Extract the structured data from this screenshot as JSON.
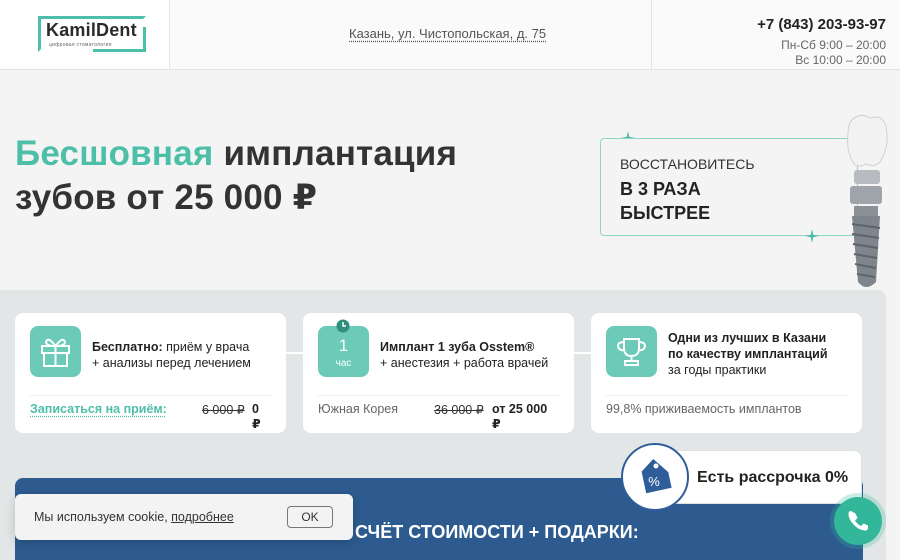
{
  "header": {
    "logo_name": "KamilDent",
    "logo_sub": "цифровая стоматология",
    "address": "Казань, ул. Чистопольская, д. 75",
    "phone": "+7 (843) 203-93-97",
    "hours_weekdays": "Пн-Сб 9:00 – 20:00",
    "hours_sunday": "Вс 10:00 – 20:00"
  },
  "hero": {
    "title_accent": "Бесшовная",
    "title_line1_rest": " имплантация",
    "title_line2": "зубов от 25 000 ₽"
  },
  "promo": {
    "top": "ВОССТАНОВИТЕСЬ",
    "line1": "В 3 РАЗА",
    "line2": "БЫСТРЕЕ"
  },
  "cards": [
    {
      "bold": "Бесплатно:",
      "text1": " приём у врача",
      "text2": "+ анализы перед лечением",
      "cta": "Записаться на приём:",
      "old_price": "6 000 ₽",
      "new_price": "0 ₽"
    },
    {
      "icon_number": "1",
      "icon_unit": "час",
      "bold": "Имплант 1 зуба Osstem®",
      "text2": "+ анестезия + работа врачей",
      "country": "Южная Корея",
      "old_price": "36 000 ₽",
      "new_price": "от 25 000 ₽"
    },
    {
      "bold1": "Одни из лучших в Казани",
      "bold2": "по качеству имплантаций",
      "text3": "за годы практики",
      "foot": "99,8% приживаемость имплантов"
    }
  ],
  "installment": {
    "label": "Есть рассрочка 0%"
  },
  "banner": {
    "text": "СЧЁТ СТОИМОСТИ + ПОДАРКИ:"
  },
  "cookie": {
    "text": "Мы используем cookie, ",
    "link": "подробнее",
    "button": "OK"
  },
  "icons": {
    "gift": "gift-icon",
    "clock": "clock-icon",
    "trophy": "trophy-icon",
    "percent_tag": "percent-tag-icon",
    "phone": "phone-icon",
    "sparkle": "sparkle-icon",
    "implant": "dental-implant-image"
  },
  "colors": {
    "accent": "#4dbfa8",
    "banner_blue": "#2d5b8f",
    "call_button": "#32b79a"
  }
}
